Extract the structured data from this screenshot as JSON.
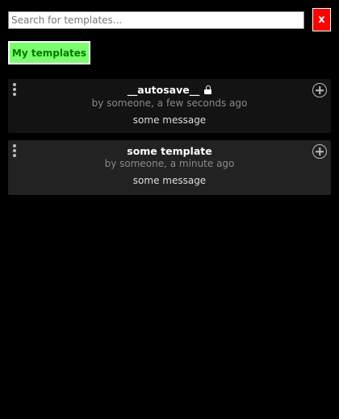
{
  "search": {
    "placeholder": "Search for templates...",
    "value": ""
  },
  "close_label": "x",
  "my_templates_label": "My templates",
  "templates": [
    {
      "title": "__autosave__",
      "locked": true,
      "meta": "by someone, a few seconds ago",
      "message": "some message"
    },
    {
      "title": "some template",
      "locked": false,
      "meta": "by someone, a minute ago",
      "message": "some message"
    }
  ],
  "colors": {
    "background": "#000000",
    "close_button": "#ff0000",
    "my_templates_button": "#7cfc6f",
    "my_templates_text": "#007a00",
    "card_1": "#131313",
    "card_2": "#222222"
  },
  "icons": {
    "card_menu": "vertical-dots-icon",
    "card_add": "circle-plus-icon",
    "locked": "lock-icon"
  }
}
